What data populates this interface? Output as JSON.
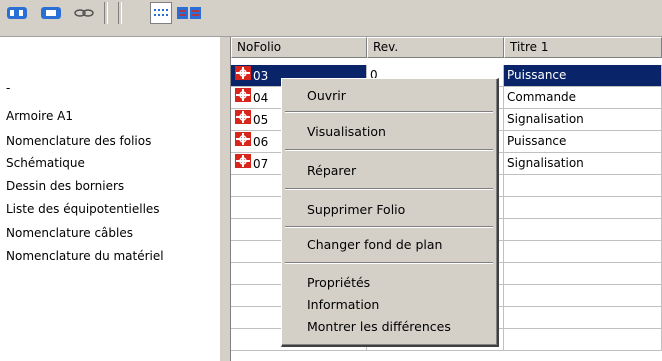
{
  "toolbar": {
    "icons": [
      "folio-add-icon",
      "folio-remove-icon",
      "link-icon",
      "list-view-icon",
      "folio-multi-icon"
    ]
  },
  "tree": {
    "items": [
      "-",
      "Armoire A1",
      "Nomenclature des folios",
      "Schématique",
      "Dessin des borniers",
      "Liste des équipotentielles",
      "Nomenclature câbles",
      "Nomenclature du matériel"
    ]
  },
  "grid": {
    "columns": [
      "NoFolio",
      "Rev.",
      "Titre 1"
    ],
    "rows": [
      {
        "folio": "03",
        "rev": "0",
        "title": "Puissance",
        "selected": true
      },
      {
        "folio": "04",
        "rev": "",
        "title": "Commande",
        "selected": false
      },
      {
        "folio": "05",
        "rev": "",
        "title": "Signalisation",
        "selected": false
      },
      {
        "folio": "06",
        "rev": "",
        "title": "Puissance",
        "selected": false
      },
      {
        "folio": "07",
        "rev": "",
        "title": "Signalisation",
        "selected": false
      }
    ]
  },
  "context_menu": {
    "items": [
      "Ouvrir",
      "Visualisation",
      "Réparer",
      "Supprimer Folio",
      "Changer fond de plan",
      "Propriétés",
      "Information",
      "Montrer les différences"
    ]
  },
  "colors": {
    "selection": "#0a246a",
    "chrome": "#d4d0c8",
    "folio_icon": "#d9261c"
  }
}
